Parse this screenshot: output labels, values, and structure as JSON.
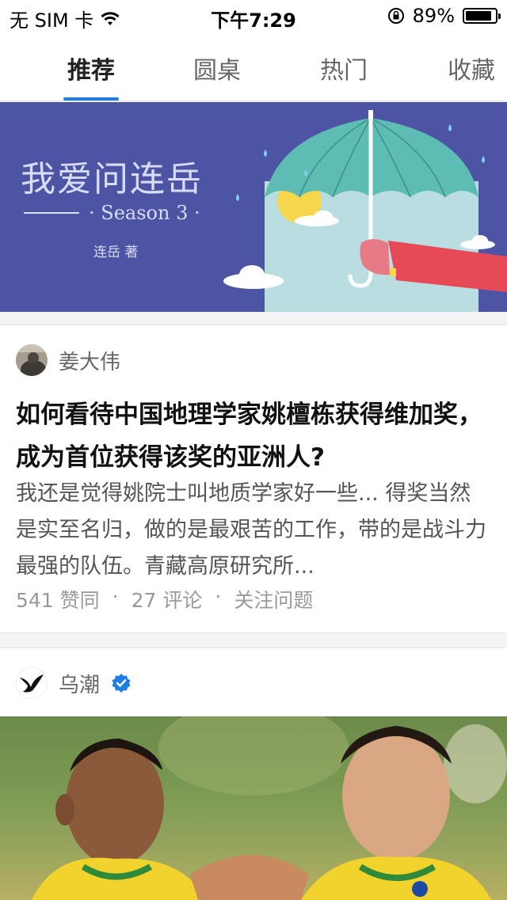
{
  "status_bar": {
    "carrier": "无 SIM 卡",
    "time": "下午7:29",
    "battery": "89%",
    "battery_level": 0.89
  },
  "tabs": [
    {
      "label": "推荐",
      "active": true
    },
    {
      "label": "圆桌",
      "active": false
    },
    {
      "label": "热门",
      "active": false
    },
    {
      "label": "收藏",
      "active": false
    }
  ],
  "banner": {
    "title": "我爱问连岳",
    "season": "· Season 3 ·",
    "author": "连岳 著",
    "colors": {
      "background": "#4e54a4",
      "umbrella": "#5dbdb4",
      "sleeve": "#e64a56"
    }
  },
  "feed": {
    "card1": {
      "author": "姜大伟",
      "title": "如何看待中国地理学家姚檀栋获得维加奖，成为首位获得该奖的亚洲人?",
      "excerpt": "我还是觉得姚院士叫地质学家好一些... 得奖当然是实至名归，做的是最艰苦的工作，带的是战斗力最强的队伍。青藏高原研究所...",
      "likes": "541 赞同",
      "comments": "27 评论",
      "follow": "关注问题",
      "sep": "·"
    },
    "card2": {
      "author": "乌潮",
      "verified_icon": "verified-badge-icon",
      "image": "football-players-photo"
    }
  }
}
